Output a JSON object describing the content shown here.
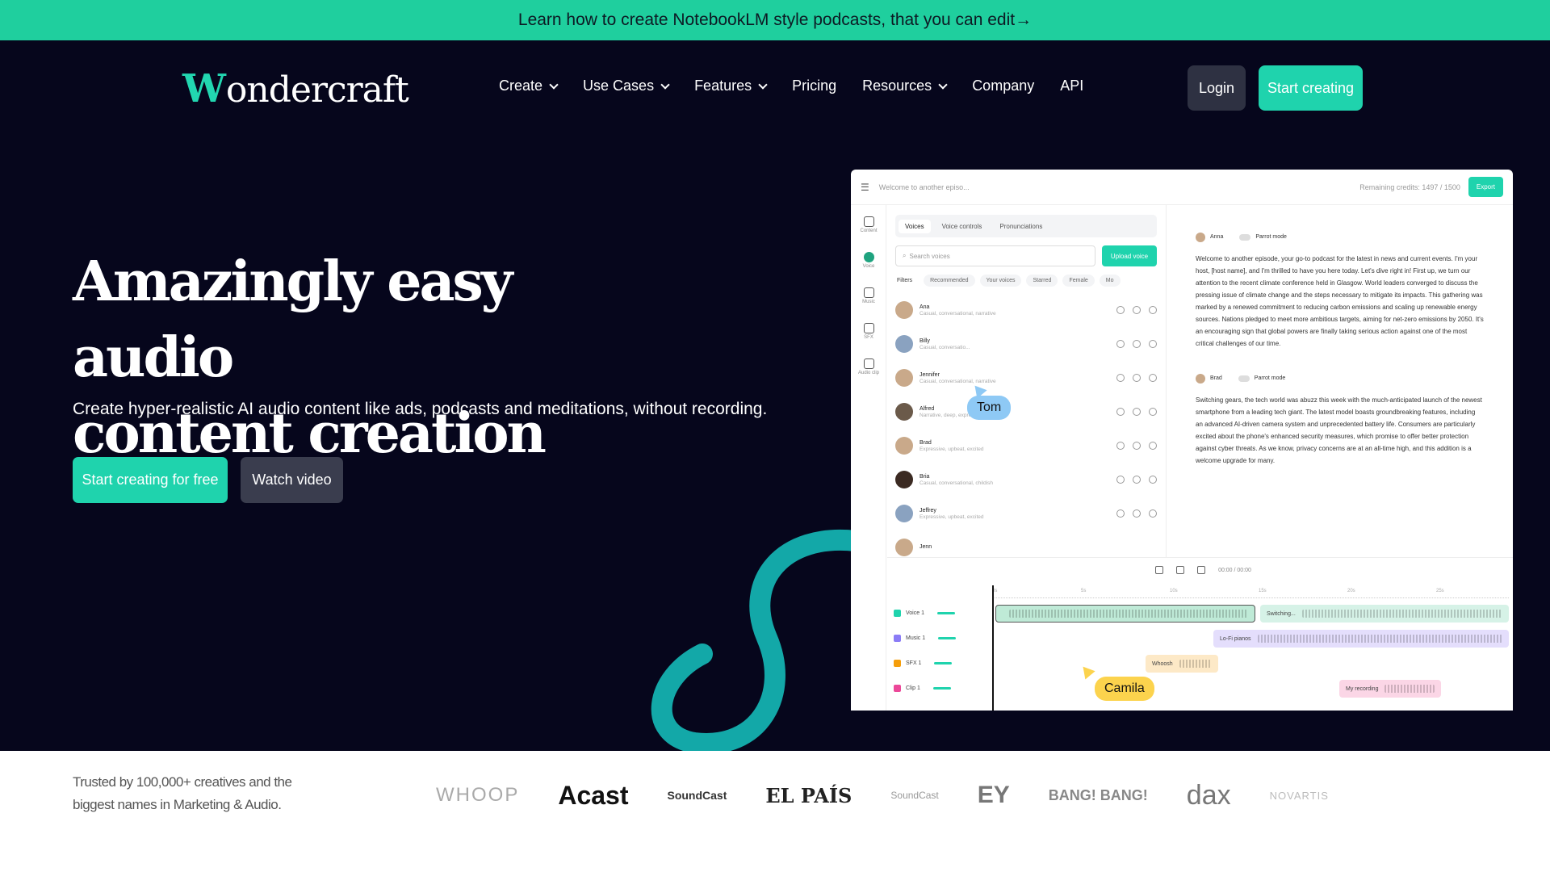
{
  "banner": {
    "text": "Learn how to create NotebookLM style podcasts, that you can edit→"
  },
  "logo": {
    "mark": "W",
    "rest": "ondercraft"
  },
  "nav": {
    "items": [
      {
        "label": "Create",
        "dropdown": true
      },
      {
        "label": "Use Cases",
        "dropdown": true
      },
      {
        "label": "Features",
        "dropdown": true
      },
      {
        "label": "Pricing",
        "dropdown": false
      },
      {
        "label": "Resources",
        "dropdown": true
      },
      {
        "label": "Company",
        "dropdown": false
      },
      {
        "label": "API",
        "dropdown": false
      }
    ],
    "login": "Login",
    "start": "Start creating"
  },
  "hero": {
    "headline_line1": "Amazingly easy audio",
    "headline_line2": "content creation",
    "subhead": "Create hyper-realistic AI audio content like ads, podcasts and meditations, without recording.",
    "cta_primary": "Start creating for free",
    "cta_secondary": "Watch video"
  },
  "app": {
    "title": "Welcome to another episo...",
    "credits": "Remaining credits: 1497 / 1500",
    "export": "Export",
    "rail": [
      "Content",
      "Voice",
      "Music",
      "SFX",
      "Audio clip"
    ],
    "tabs": [
      "Voices",
      "Voice controls",
      "Pronunciations"
    ],
    "search_placeholder": "Search voices",
    "upload": "Upload voice",
    "filters": [
      "Filters",
      "Recommended",
      "Your voices",
      "Starred",
      "Female",
      "Mo"
    ],
    "voices": [
      {
        "name": "Ana",
        "desc": "Casual, conversational, narrative"
      },
      {
        "name": "Billy",
        "desc": "Casual, conversatio..."
      },
      {
        "name": "Jennifer",
        "desc": "Casual, conversational, narrative"
      },
      {
        "name": "Alfred",
        "desc": "Narrative, deep, expressive"
      },
      {
        "name": "Brad",
        "desc": "Expressive, upbeat, excited"
      },
      {
        "name": "Bria",
        "desc": "Casual, conversational, childish"
      },
      {
        "name": "Jeffrey",
        "desc": "Expressive, upbeat, excited"
      },
      {
        "name": "Jenn",
        "desc": ""
      }
    ],
    "editor": {
      "speaker1": "Anna",
      "speaker2": "Brad",
      "parrot": "Parrot mode",
      "para1": "Welcome to another episode, your go-to podcast for the latest in news and current events. I'm your host, [host name], and I'm thrilled to have you here today. Let's dive right in! First up, we turn our attention to the recent climate conference held in Glasgow. World leaders converged to discuss the pressing issue of climate change and the steps necessary to mitigate its impacts. This gathering was marked by a renewed commitment to reducing carbon emissions and scaling up renewable energy sources. Nations pledged to meet more ambitious targets, aiming for net-zero emissions by 2050. It's an encouraging sign that global powers are finally taking serious action against one of the most critical challenges of our time.",
      "para2": "Switching gears, the tech world was abuzz this week with the much-anticipated launch of the newest smartphone from a leading tech giant. The latest model boasts groundbreaking features, including an advanced AI-driven camera system and unprecedented battery life. Consumers are particularly excited about the phone's enhanced security measures, which promise to offer better protection against cyber threats. As we know, privacy concerns are at an all-time high, and this addition is a welcome upgrade for many."
    },
    "timeline": {
      "time": "00:00 / 00:00",
      "ruler": [
        "0s",
        "5s",
        "10s",
        "15s",
        "20s",
        "25s"
      ],
      "tracks": [
        "Voice 1",
        "Music 1",
        "SFX 1",
        "Clip 1"
      ],
      "clips": {
        "switching": "Switching...",
        "music": "Lo-Fi pianos",
        "sfx": "Whoosh",
        "clip": "My recording"
      }
    },
    "cursors": {
      "tom": "Tom",
      "camila": "Camila"
    }
  },
  "trusted": {
    "text": "Trusted by 100,000+ creatives and the biggest names in Marketing & Audio."
  },
  "brands": [
    "WHOOP",
    "Acast",
    "SoundCast",
    "EL PAÍS",
    "SoundCast",
    "EY",
    "BANG! BANG!",
    "dax",
    "NOVARTIS"
  ]
}
